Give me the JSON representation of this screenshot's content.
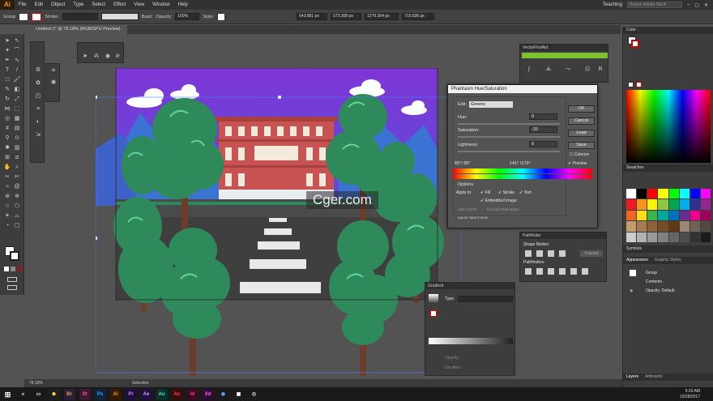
{
  "menu": {
    "logo": "Ai",
    "items": [
      "File",
      "Edit",
      "Object",
      "Type",
      "Select",
      "Effect",
      "View",
      "Window",
      "Help"
    ],
    "workspace": "Teaching",
    "search_placeholder": "Search Adobe Stock"
  },
  "control": {
    "selection": "Group",
    "stroke_label": "Stroke:",
    "basic": "Basic",
    "opacity_label": "Opacity:",
    "opacity_value": "100%",
    "style_label": "Style:",
    "x_value": "543.861 px",
    "y_value": "573.309 px",
    "w_value": "1276.364 px",
    "h_value": "715.636 px"
  },
  "document": {
    "tab_label": "Untitled-1* @ 78.18% (RGB/GPU Preview)"
  },
  "status": {
    "zoom": "78.18%",
    "tool": "Selection"
  },
  "vfa_panel": {
    "title": "VectorFirstAid"
  },
  "dialog": {
    "title": "Phantasm Hue/Saturation",
    "edit_label": "Edit:",
    "edit_value": "Greens",
    "hue_label": "Hue:",
    "hue_value": "0",
    "saturation_label": "Saturation:",
    "saturation_value": "-20",
    "lightness_label": "Lightness:",
    "lightness_value": "0",
    "range_left": "65°/ 95°",
    "range_right": "141° \\170°",
    "options_label": "Options",
    "apply_to": "Apply to:",
    "fill": "Fill",
    "stroke": "Stroke",
    "text": "Text",
    "embedded": "Embedded image",
    "safe_cmyk": "Safe CMYK",
    "exclude_black": "Exclude Plain Black",
    "ignore_spot": "Ignore Spot Colors",
    "buttons": {
      "ok": "OK",
      "cancel": "Cancel",
      "load": "Load",
      "save": "Save"
    },
    "colorize": "Colorize",
    "preview": "Preview"
  },
  "pathfinder": {
    "title": "Pathfinder",
    "shape_modes": "Shape Modes:",
    "pathfinders": "Pathfinders:",
    "expand": "Expand"
  },
  "gradient": {
    "title": "Gradient",
    "type_label": "Type:",
    "opacity": "Opacity:",
    "location": "Location:"
  },
  "right_panel": {
    "color_tab": "Color",
    "swatches_tab": "Swatches",
    "symbols_tab": "Symbols",
    "appearance_tab": "Appearance",
    "graphic_styles_tab": "Graphic Styles",
    "appearance_group": "Group",
    "contents": "Contents",
    "opacity_row": "Opacity: Default",
    "layers_tab": "Layers",
    "artboards_tab": "Artboards"
  },
  "watermark": "Cger.com",
  "taskbar": {
    "time": "9:33 AM",
    "date": "10/28/2017",
    "apps": [
      {
        "label": "Br",
        "bg": "#2b1f3a",
        "fg": "#e8a34b"
      },
      {
        "label": "St",
        "bg": "#3d1a2b",
        "fg": "#f05ba6"
      },
      {
        "label": "Ps",
        "bg": "#0e2438",
        "fg": "#31a8ff"
      },
      {
        "label": "Ai",
        "bg": "#331c00",
        "fg": "#ff9a00"
      },
      {
        "label": "Pr",
        "bg": "#1e0f3b",
        "fg": "#e17dff"
      },
      {
        "label": "Ae",
        "bg": "#1f1040",
        "fg": "#d59bff"
      },
      {
        "label": "Au",
        "bg": "#07322b",
        "fg": "#4de3c3"
      },
      {
        "label": "Ac",
        "bg": "#3a0c0c",
        "fg": "#ff4a4a"
      },
      {
        "label": "Id",
        "bg": "#3a0a1f",
        "fg": "#ff3b8a"
      },
      {
        "label": "Xd",
        "bg": "#2e0a2e",
        "fg": "#ff61f6"
      }
    ]
  }
}
